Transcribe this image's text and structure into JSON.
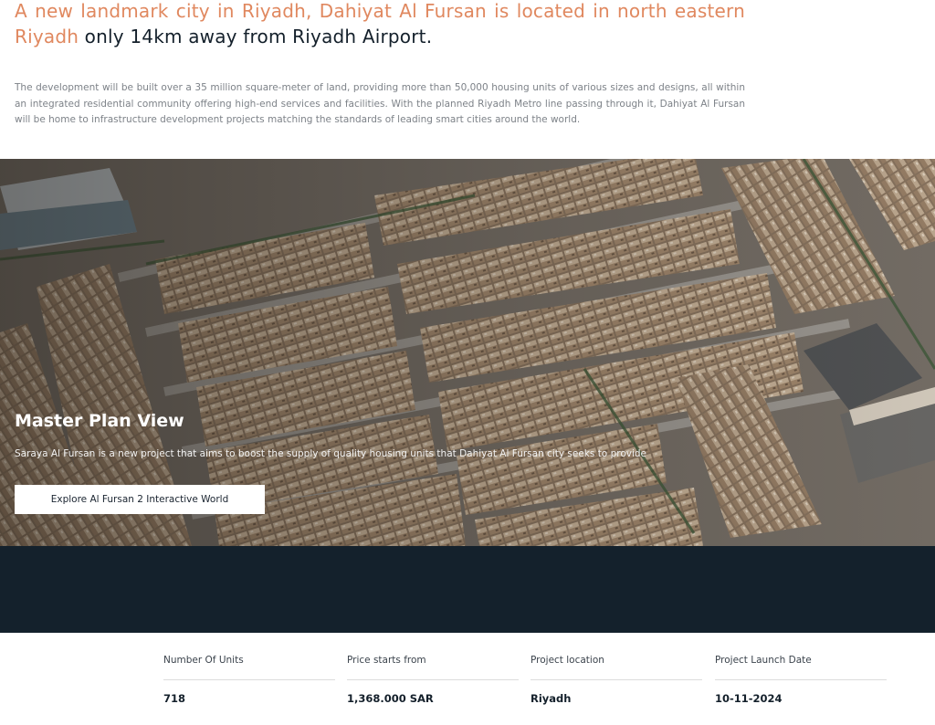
{
  "intro": {
    "headline_accent_1": "A new landmark city in Riyadh, Dahiyat Al Fursan is located in north eastern",
    "headline_accent_2": "Riyadh",
    "headline_rest": " only 14km away from Riyadh Airport.",
    "body": "The development will be built over a 35 million square-meter of land, providing more than 50,000 housing units of various sizes and designs, all within an integrated residential community offering high-end services and facilities. With the planned Riyadh Metro line passing through it, Dahiyat Al Fursan will be home to infrastructure development projects matching the standards of leading smart cities around the world."
  },
  "hero": {
    "title": "Master Plan View",
    "subtitle": "Saraya Al Fursan is a new project that aims to boost the supply of quality housing units that Dahiyat Al Fursan city seeks to provide",
    "button_label": "Explore Al Fursan 2 Interactive World",
    "image_description_icon": "aerial-masterplan-image"
  },
  "stats": [
    {
      "label": "Number Of Units",
      "value": "718"
    },
    {
      "label": "Price starts from",
      "value": "1,368.000 SAR"
    },
    {
      "label": "Project location",
      "value": "Riyadh"
    },
    {
      "label": "Project Launch Date",
      "value": "10-11-2024"
    }
  ],
  "colors": {
    "accent": "#e0885f",
    "dark_band": "#14212c",
    "text_dark": "#14202b",
    "text_muted": "#7d8288"
  }
}
